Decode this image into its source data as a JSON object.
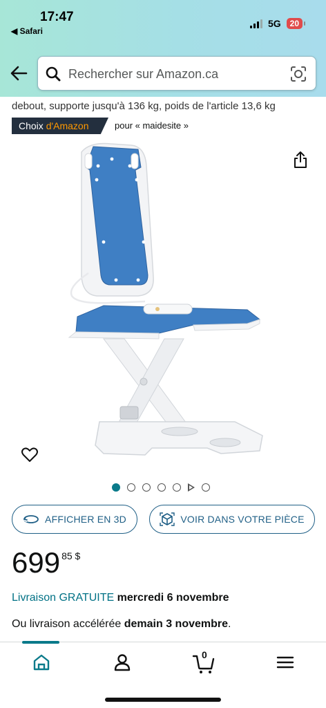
{
  "status_bar": {
    "time": "17:47",
    "back_app": "◀ Safari",
    "network": "5G",
    "battery": "20",
    "battery_color": "#e04b4b"
  },
  "header": {
    "search_placeholder": "Rechercher sur Amazon.ca",
    "icons": [
      "back-arrow-icon",
      "search-icon",
      "camera-lens-icon"
    ]
  },
  "product": {
    "title_line": "debout, supporte jusqu'à 136 kg, poids de l'article 13,6 kg",
    "badge_prefix": "Choix ",
    "badge_accent": "d'Amazon",
    "badge_for": "pour « maidesite »",
    "image_alt": "Bath lift chair with blue padded seat and white scissor base",
    "carousel_count": 6,
    "carousel_active": 1
  },
  "actions": {
    "view_3d": "AFFICHER EN 3D",
    "view_room": "VOIR DANS VOTRE PIÈCE"
  },
  "price": {
    "whole": "699",
    "fraction": "85 $"
  },
  "delivery": {
    "free_label": "Livraison GRATUITE",
    "free_date": "mercredi 6 novembre",
    "fast_prefix": "Ou livraison accélérée ",
    "fast_date": "demain 3 novembre",
    "fast_suffix": "."
  },
  "bottom_nav": {
    "cart_count": "0",
    "items": [
      "home",
      "account",
      "cart",
      "menu"
    ]
  },
  "colors": {
    "accent_teal": "#0a7a8a",
    "link": "#007185",
    "badge_bg": "#232f3e",
    "badge_accent": "#ff9900"
  }
}
